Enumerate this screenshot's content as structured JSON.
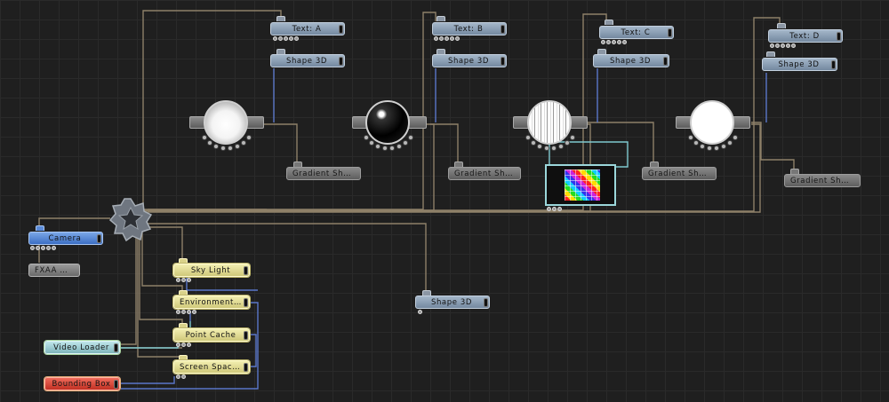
{
  "nodes": {
    "text_a": "Text: A",
    "text_b": "Text: B",
    "text_c": "Text: C",
    "text_d": "Text: D",
    "shape3d_a": "Shape 3D",
    "shape3d_b": "Shape 3D",
    "shape3d_c": "Shape 3D",
    "shape3d_d": "Shape 3D",
    "shape3d_mid": "Shape 3D",
    "gradient_a": "Gradient Shading ...",
    "gradient_b": "Gradient Shading ...",
    "gradient_c": "Gradient Shading ...",
    "gradient_d": "Gradient Shading ...",
    "camera": "Camera",
    "fxaa": "FXAA Anti...",
    "sky_light": "Sky Light",
    "environment_map": "Environment Map",
    "point_cache": "Point Cache",
    "screen_space": "Screen Space Refl...",
    "video_loader": "Video Loader",
    "bounding_box": "Bounding Box"
  },
  "colors": {
    "background": "#1f1f1f",
    "wire": "#8e8069",
    "wire_blue": "#5a77c9",
    "wire_cyan": "#7fc8cf",
    "node_blue": "#8ea2b8",
    "node_camera": "#4d7fd4",
    "node_gray": "#7e7e7e",
    "node_yellow": "#e6df9a",
    "node_teal": "#9fcfd5",
    "node_red": "#de4a3a"
  },
  "icons": {
    "hub": "gear-icon",
    "preview_a": "white-sphere-preview",
    "preview_b": "black-glossy-sphere-preview",
    "preview_c": "striped-sphere-preview",
    "preview_d": "flat-white-sphere-preview",
    "video_preview": "rainbow-checker-preview"
  }
}
